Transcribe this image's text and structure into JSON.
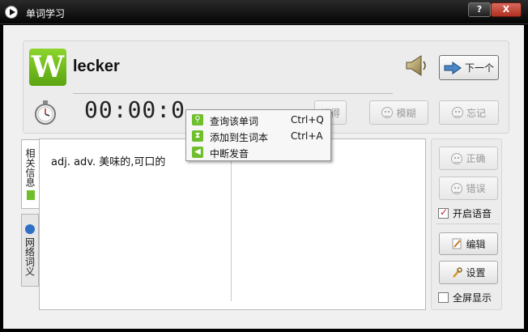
{
  "window": {
    "title": "单词学习",
    "help_label": "?",
    "close_label": "X"
  },
  "word": {
    "logo_letter": "W",
    "text": "lecker",
    "timer": "00:00:0"
  },
  "actions": {
    "next_label": "下一个",
    "remember_label": "记得",
    "vague_label": "模糊",
    "forget_label": "忘记"
  },
  "tabs": [
    {
      "label": "相关信息"
    },
    {
      "label": "网络词义"
    }
  ],
  "content": {
    "definition": "adj. adv. 美味的,可口的"
  },
  "side": {
    "correct_label": "正确",
    "wrong_label": "错误",
    "voice_label": "开启语音",
    "voice_checked": true,
    "edit_label": "编辑",
    "settings_label": "设置",
    "fullscreen_label": "全屏显示",
    "fullscreen_checked": false
  },
  "context_menu": {
    "items": [
      {
        "label": "查询该单词",
        "shortcut": "Ctrl+Q",
        "icon": "magnifier-icon"
      },
      {
        "label": "添加到生词本",
        "shortcut": "Ctrl+A",
        "icon": "hourglass-icon"
      },
      {
        "label": "中断发音",
        "shortcut": "",
        "icon": "speaker-icon"
      }
    ]
  },
  "colors": {
    "accent_green": "#6fbf2d",
    "title_bar": "#1a1a1a",
    "close_red": "#c0392b"
  }
}
